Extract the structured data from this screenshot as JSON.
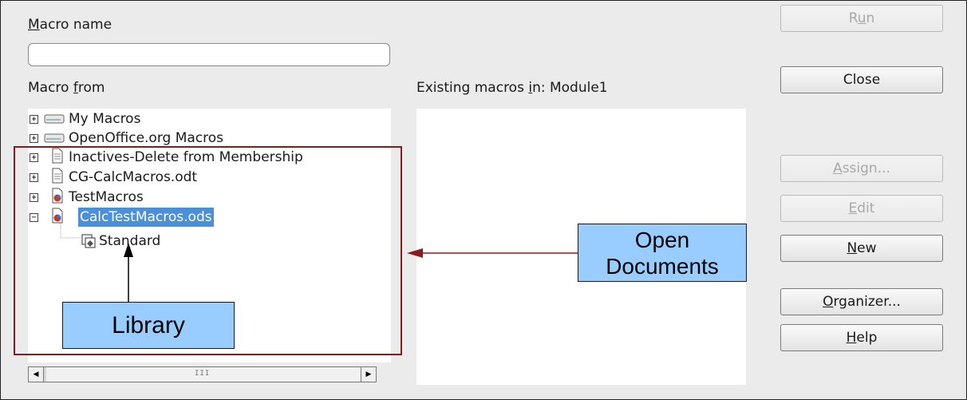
{
  "labels": {
    "macro_name": "Macro name",
    "macro_from": "Macro from",
    "existing": "Existing macros in: Module1"
  },
  "macro_name_value": "",
  "tree": [
    {
      "label": "My Macros",
      "expander": "+",
      "icon": "drive-icon"
    },
    {
      "label": "OpenOffice.org Macros",
      "expander": "+",
      "icon": "drive-icon"
    },
    {
      "label": "Inactives-Delete from Membership",
      "expander": "+",
      "icon": "text-document-icon"
    },
    {
      "label": "CG-CalcMacros.odt",
      "expander": "+",
      "icon": "text-document-icon"
    },
    {
      "label": "TestMacros",
      "expander": "+",
      "icon": "spreadsheet-document-icon"
    },
    {
      "label": "CalcTestMacros.ods",
      "expander": "−",
      "icon": "spreadsheet-document-icon",
      "selected": true
    },
    {
      "label": "Standard",
      "icon": "library-icon"
    }
  ],
  "buttons": {
    "run": "Run",
    "close": "Close",
    "assign": "Assign...",
    "edit": "Edit",
    "new": "New",
    "organizer": "Organizer...",
    "help": "Help"
  },
  "annotations": {
    "library": "Library",
    "open_docs_line1": "Open",
    "open_docs_line2": "Documents"
  },
  "colors": {
    "highlight_box": "#8b1a1a",
    "callout_fill": "#99ccff",
    "selection": "#4a90d9"
  }
}
